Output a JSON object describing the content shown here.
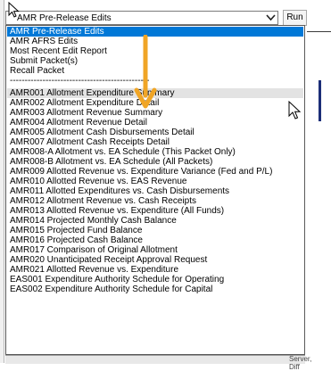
{
  "report_select": {
    "value": "AMR Pre-Release Edits",
    "run_label": "Run"
  },
  "options": [
    {
      "label": "AMR Pre-Release Edits",
      "state": "selected"
    },
    {
      "label": "AMR AFRS Edits",
      "state": "normal"
    },
    {
      "label": "Most Recent Edit Report",
      "state": "normal"
    },
    {
      "label": "Submit Packet(s)",
      "state": "normal"
    },
    {
      "label": "Recall Packet",
      "state": "normal"
    },
    {
      "label": "-----------------------------------------------",
      "state": "normal"
    },
    {
      "label": "AMR001 Allotment Expenditure Summary",
      "state": "hover"
    },
    {
      "label": "AMR002 Allotment Expenditure Detail",
      "state": "normal"
    },
    {
      "label": "AMR003 Allotment Revenue Summary",
      "state": "normal"
    },
    {
      "label": "AMR004 Allotment Revenue Detail",
      "state": "normal"
    },
    {
      "label": "AMR005 Allotment Cash Disbursements Detail",
      "state": "normal"
    },
    {
      "label": "AMR007 Allotment Cash Receipts Detail",
      "state": "normal"
    },
    {
      "label": "AMR008-A Allotment vs. EA Schedule (This Packet Only)",
      "state": "normal"
    },
    {
      "label": "AMR008-B Allotment vs. EA Schedule (All Packets)",
      "state": "normal"
    },
    {
      "label": "AMR009 Allotted Revenue vs. Expenditure Variance (Fed and P/L)",
      "state": "normal"
    },
    {
      "label": "AMR010 Allotted Revenue vs. EAS Revenue",
      "state": "normal"
    },
    {
      "label": "AMR011 Allotted Expenditures vs. Cash Disbursements",
      "state": "normal"
    },
    {
      "label": "AMR012 Allotment Revenue vs. Cash Receipts",
      "state": "normal"
    },
    {
      "label": "AMR013 Allotted Revenue vs. Expenditure (All Funds)",
      "state": "normal"
    },
    {
      "label": "AMR014 Projected Monthly Cash Balance",
      "state": "normal"
    },
    {
      "label": "AMR015 Projected Fund Balance",
      "state": "normal"
    },
    {
      "label": "AMR016 Projected Cash Balance",
      "state": "normal"
    },
    {
      "label": "AMR017 Comparison of Original Allotment",
      "state": "normal"
    },
    {
      "label": "AMR020 Unanticipated Receipt Approval Request",
      "state": "normal"
    },
    {
      "label": "AMR021 Allotted Revenue vs. Expenditure",
      "state": "normal"
    },
    {
      "label": "EAS001 Expenditure Authority Schedule for Operating",
      "state": "normal"
    },
    {
      "label": "EAS002 Expenditure Authority Schedule for Capital",
      "state": "normal"
    }
  ],
  "background": {
    "partial_text": "Server, Diff"
  },
  "colors": {
    "selected_bg": "#0078d7",
    "hover_bg": "#e3e3e3",
    "arrow": "#f0a526"
  },
  "icons": {
    "dropdown": "chevron-down-icon",
    "annotation": "arrow-down-icon",
    "pointer": "mouse-pointer-icon"
  }
}
